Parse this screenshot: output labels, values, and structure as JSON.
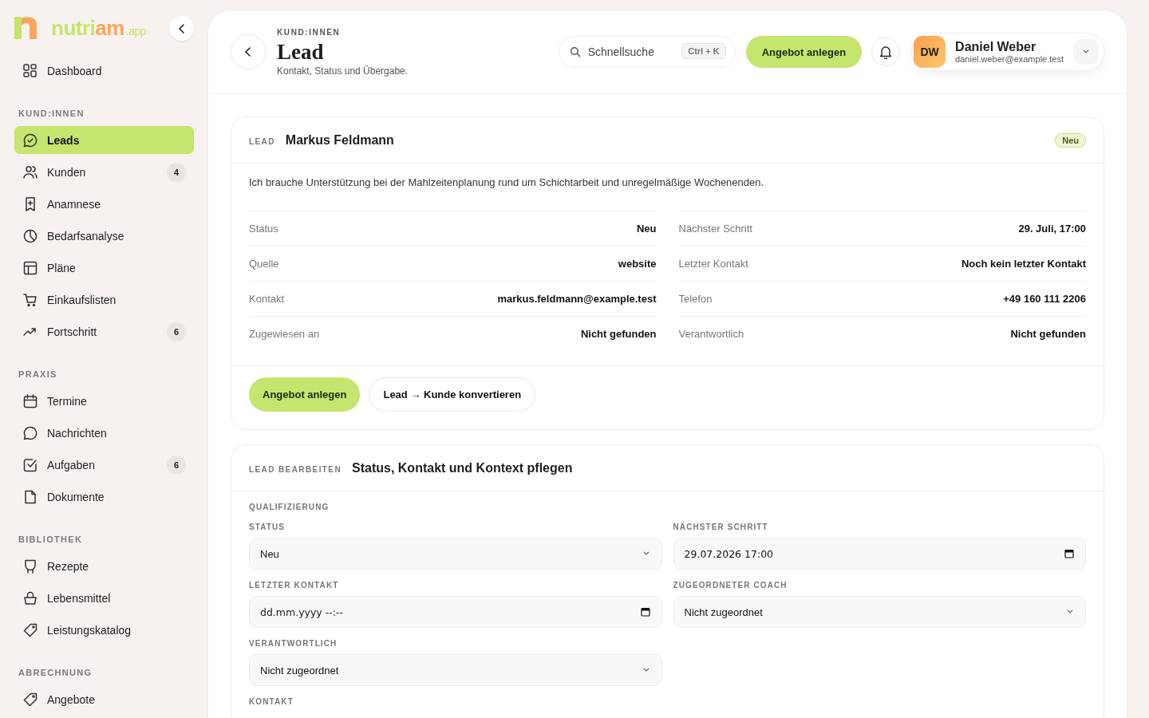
{
  "logo": {
    "start": "nutri",
    "end": "am",
    "suffix": ".app"
  },
  "sidebar": {
    "sections": [
      {
        "items": [
          {
            "label": "Dashboard",
            "selected": false
          }
        ]
      },
      {
        "heading": "KUND:INNEN",
        "items": [
          {
            "label": "Leads",
            "selected": true
          },
          {
            "label": "Kunden",
            "selected": false,
            "badge": "4"
          },
          {
            "label": "Anamnese",
            "selected": false
          },
          {
            "label": "Bedarfsanalyse",
            "selected": false
          },
          {
            "label": "Pläne",
            "selected": false
          },
          {
            "label": "Einkaufslisten",
            "selected": false
          },
          {
            "label": "Fortschritt",
            "selected": false,
            "badge": "6"
          }
        ]
      },
      {
        "heading": "PRAXIS",
        "items": [
          {
            "label": "Termine",
            "selected": false
          },
          {
            "label": "Nachrichten",
            "selected": false
          },
          {
            "label": "Aufgaben",
            "selected": false,
            "badge": "6"
          },
          {
            "label": "Dokumente",
            "selected": false
          }
        ]
      },
      {
        "heading": "BIBLIOTHEK",
        "items": [
          {
            "label": "Rezepte",
            "selected": false
          },
          {
            "label": "Lebensmittel",
            "selected": false
          },
          {
            "label": "Leistungskatalog",
            "selected": false
          }
        ]
      },
      {
        "heading": "ABRECHNUNG",
        "items": [
          {
            "label": "Angebote",
            "selected": false
          }
        ]
      }
    ]
  },
  "header": {
    "eyebrow": "KUND:INNEN",
    "title": "Lead",
    "subtitle": "Kontakt, Status und Übergabe.",
    "search": {
      "placeholder": "Schnellsuche",
      "shortcut": "Ctrl + K"
    },
    "primary_button": "Angebot anlegen",
    "user": {
      "initials": "DW",
      "name": "Daniel Weber",
      "email": "daniel.weber@example.test"
    }
  },
  "lead_card": {
    "eyebrow": "LEAD",
    "name": "Markus Feldmann",
    "badge": "Neu",
    "message": "Ich brauche Unterstützung bei der Mahlzeitenplanung rund um Schichtarbeit und unregelmäßige Wochenenden.",
    "details_left": [
      {
        "label": "Status",
        "value": "Neu"
      },
      {
        "label": "Quelle",
        "value": "website"
      },
      {
        "label": "Kontakt",
        "value": "markus.feldmann@example.test"
      },
      {
        "label": "Zugewiesen an",
        "value": "Nicht gefunden"
      }
    ],
    "details_right": [
      {
        "label": "Nächster Schritt",
        "value": "29. Juli, 17:00"
      },
      {
        "label": "Letzter Kontakt",
        "value": "Noch kein letzter Kontakt"
      },
      {
        "label": "Telefon",
        "value": "+49 160 111 2206"
      },
      {
        "label": "Verantwortlich",
        "value": "Nicht gefunden"
      }
    ],
    "actions": [
      {
        "label": "Angebot anlegen",
        "kind": "primary"
      },
      {
        "label": "Lead → Kunde konvertieren",
        "kind": "secondary"
      }
    ]
  },
  "edit_card": {
    "eyebrow": "LEAD BEARBEITEN",
    "title": "Status, Kontakt und Kontext pflegen",
    "group": "QUALIFIZIERUNG",
    "fields": [
      {
        "label": "STATUS",
        "kind": "select",
        "value": "Neu"
      },
      {
        "label": "NÄCHSTER SCHRITT",
        "kind": "datetime",
        "value": "29.07.2026 17:00"
      },
      {
        "label": "LETZTER KONTAKT",
        "kind": "datetime",
        "placeholder": "dd.mm.yyyy --:--"
      },
      {
        "label": "ZUGEORDNETER COACH",
        "kind": "select",
        "value": "Nicht zugeordnet"
      },
      {
        "label": "VERANTWORTLICH",
        "kind": "select",
        "value": "Nicht zugeordnet"
      }
    ],
    "next_group": "KONTAKT"
  }
}
